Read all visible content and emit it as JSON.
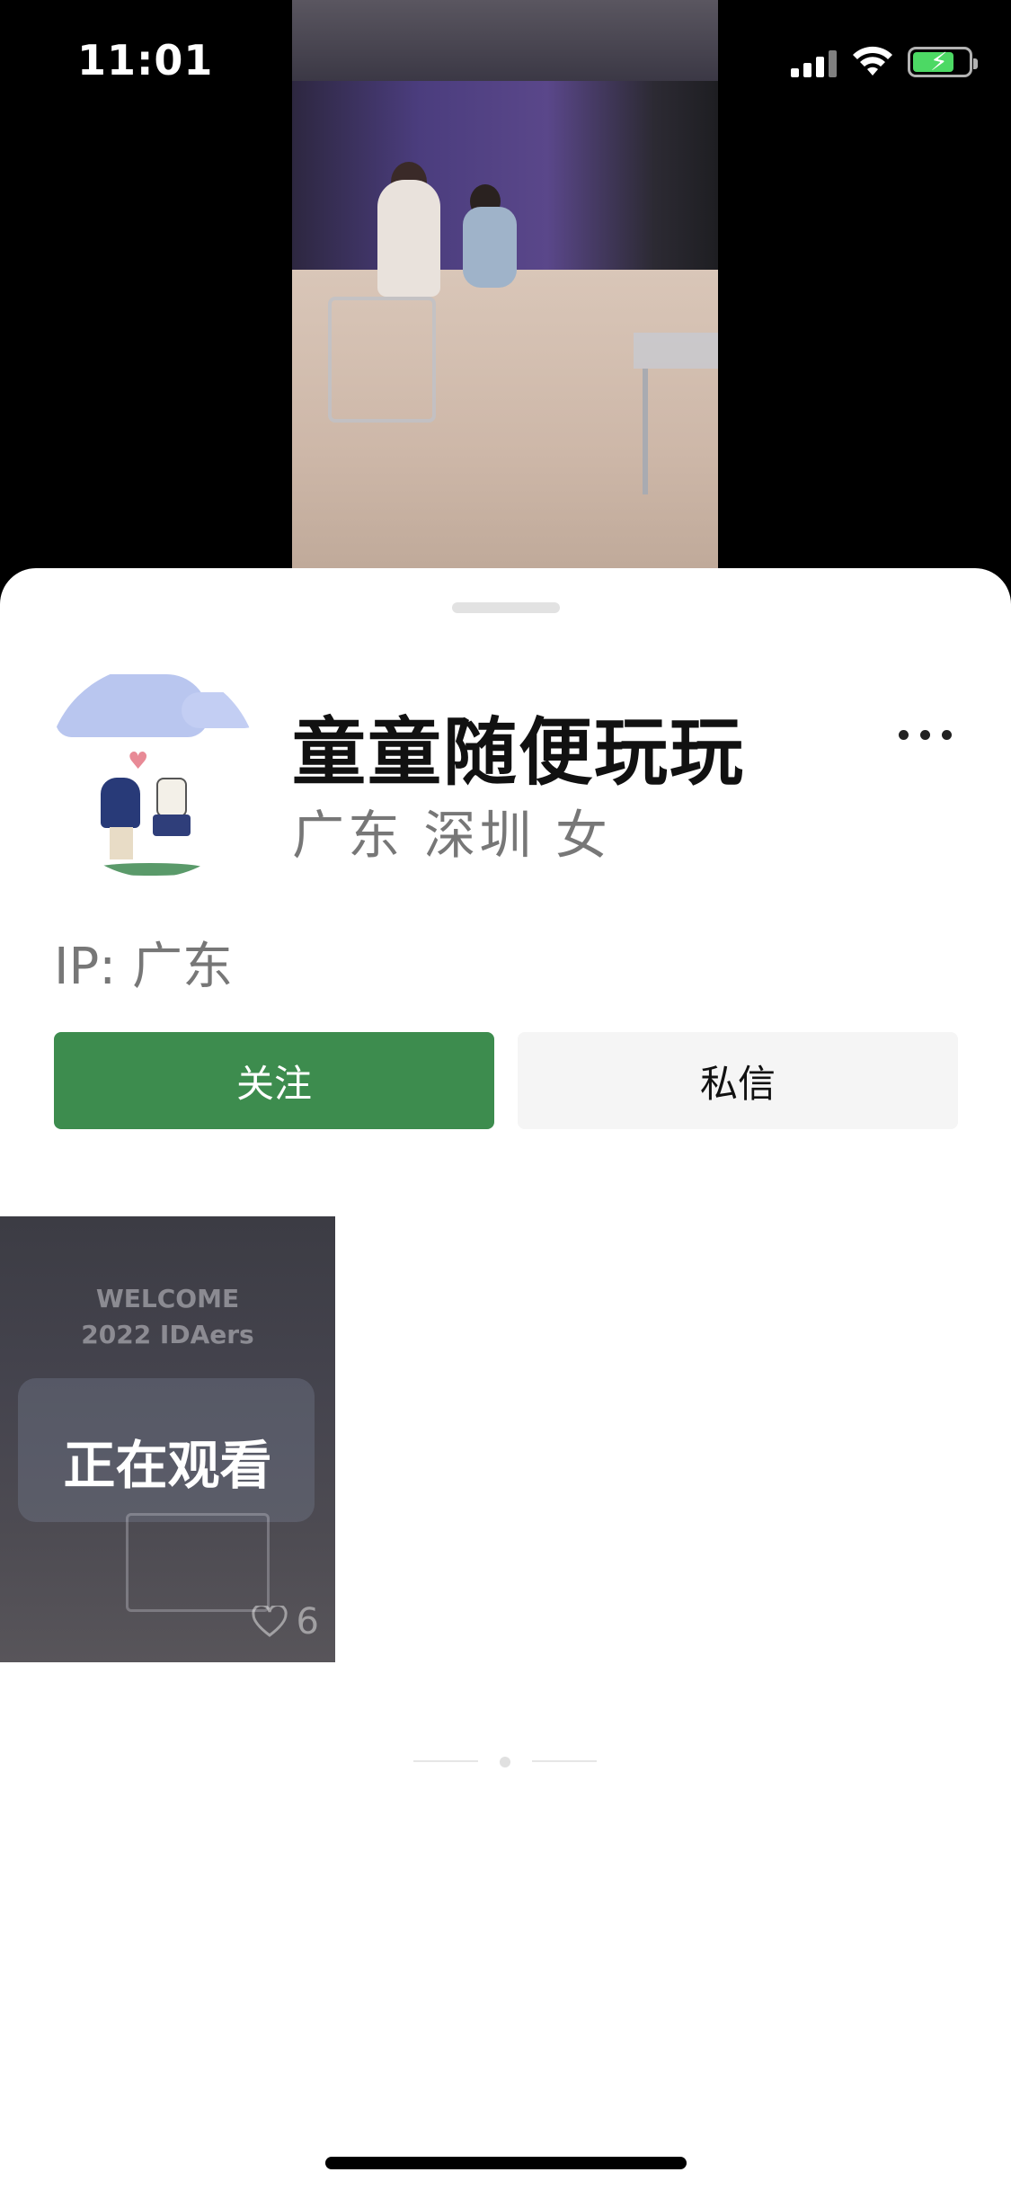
{
  "status_bar": {
    "time": "11:01",
    "signal_icon": "cellular-signal-icon",
    "wifi_icon": "wifi-icon",
    "battery_icon": "battery-charging-icon",
    "battery_level": 0.75,
    "battery_color": "#4cd964"
  },
  "video": {
    "description_icon": "video-preview"
  },
  "profile": {
    "name": "童童随便玩玩",
    "location": "广东 深圳 女",
    "ip": "IP: 广东",
    "more_icon": "more-dots-icon"
  },
  "actions": {
    "follow_label": "关注",
    "message_label": "私信",
    "follow_color": "#3d8c4e"
  },
  "videos": [
    {
      "overlay_text": "WELCOME",
      "overlay_subtext": "2022 IDAers",
      "status_label": "正在观看",
      "likes": "6",
      "like_icon": "heart-outline-icon"
    }
  ]
}
